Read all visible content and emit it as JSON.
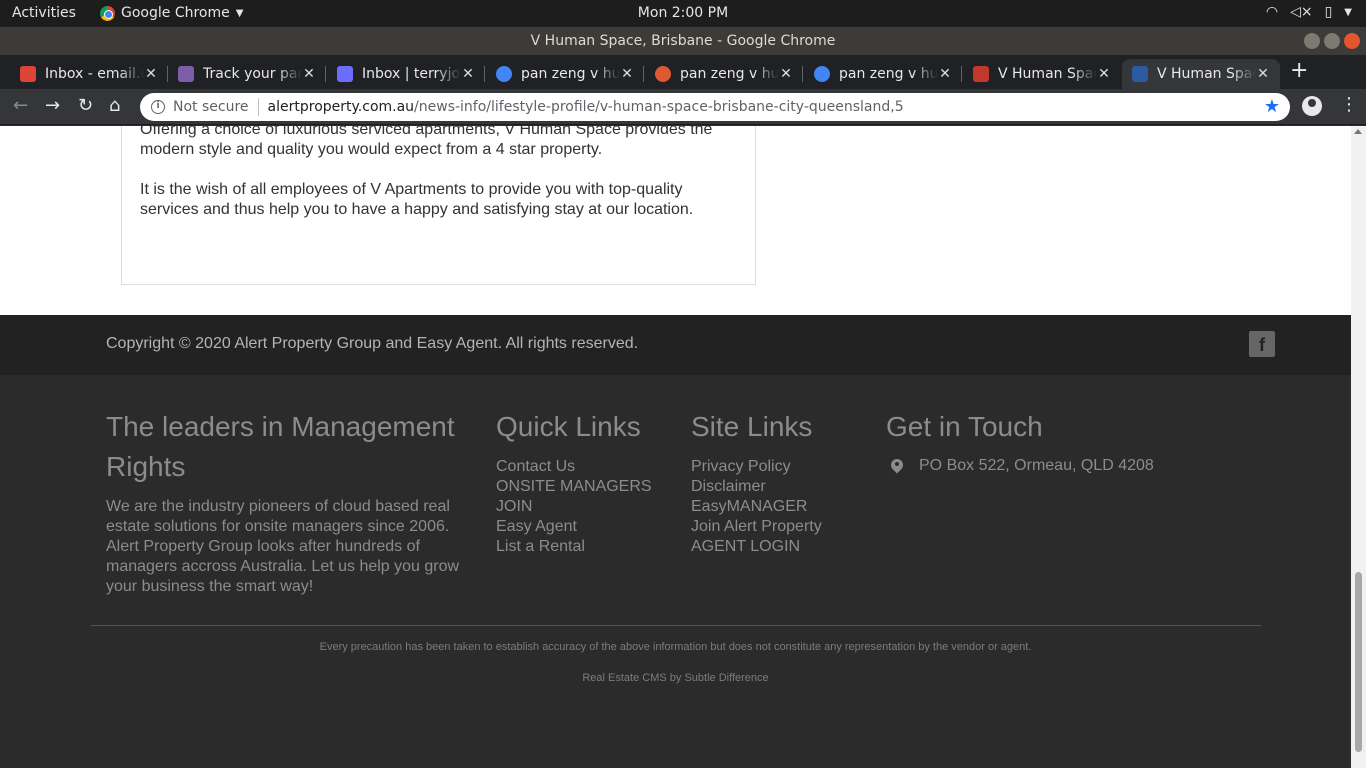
{
  "system": {
    "activities": "Activities",
    "app_name": "Google Chrome",
    "clock": "Mon  2:00 PM"
  },
  "window": {
    "title": "V Human Space, Brisbane - Google Chrome"
  },
  "tabs": [
    {
      "label": "Inbox - email.u",
      "favicon": "gmail-icon",
      "color": "#db4437"
    },
    {
      "label": "Track your parcel",
      "favicon": "parcel-icon",
      "color": "#7b5ea7"
    },
    {
      "label": "Inbox | terryjones",
      "favicon": "mail-lock-icon",
      "color": "#6c6cff"
    },
    {
      "label": "pan zeng v hu",
      "favicon": "google-icon",
      "color": "#4285f4"
    },
    {
      "label": "pan zeng v hu",
      "favicon": "duckduckgo-icon",
      "color": "#de5833"
    },
    {
      "label": "pan zeng v hu",
      "favicon": "google-icon",
      "color": "#4285f4"
    },
    {
      "label": "V Human Space",
      "favicon": "alert-property-icon",
      "color": "#c0392b"
    },
    {
      "label": "V Human Space",
      "favicon": "home-icon",
      "color": "#2c5aa0"
    }
  ],
  "toolbar": {
    "security": "Not secure",
    "url_domain": "alertproperty.com.au",
    "url_path": "/news-info/lifestyle-profile/v-human-space-brisbane-city-queensland,5"
  },
  "article": {
    "p1": "Offering a choice of luxurious serviced apartments, V Human Space provides the modern style and quality you would expect from a 4 star property.",
    "p2": "It is the wish of all employees of V Apartments to provide you with top-quality services and thus help you to have a happy and satisfying stay at our location."
  },
  "footer": {
    "copyright": "Copyright © 2020 Alert Property Group and Easy Agent. All rights reserved.",
    "facebook": "f",
    "about_title": "The leaders in Management Rights",
    "about_text": "We are the industry pioneers of cloud based real estate solutions for onsite managers since 2006. Alert Property Group looks after hundreds of managers accross Australia. Let us help you grow your business the smart way!",
    "quick_title": "Quick Links",
    "quick_links": [
      "Contact Us",
      "ONSITE MANAGERS",
      "JOIN",
      "Easy Agent",
      "List a Rental"
    ],
    "site_title": "Site Links",
    "site_links": [
      "Privacy Policy",
      "Disclaimer",
      "EasyMANAGER",
      "Join Alert Property",
      "AGENT LOGIN"
    ],
    "touch_title": "Get in Touch",
    "address": "PO Box 522, Ormeau, QLD 4208",
    "disclaimer": "Every precaution has been taken to establish accuracy of the above information but does not constitute any representation by the vendor or agent.",
    "cms": "Real Estate CMS by Subtle Difference"
  }
}
